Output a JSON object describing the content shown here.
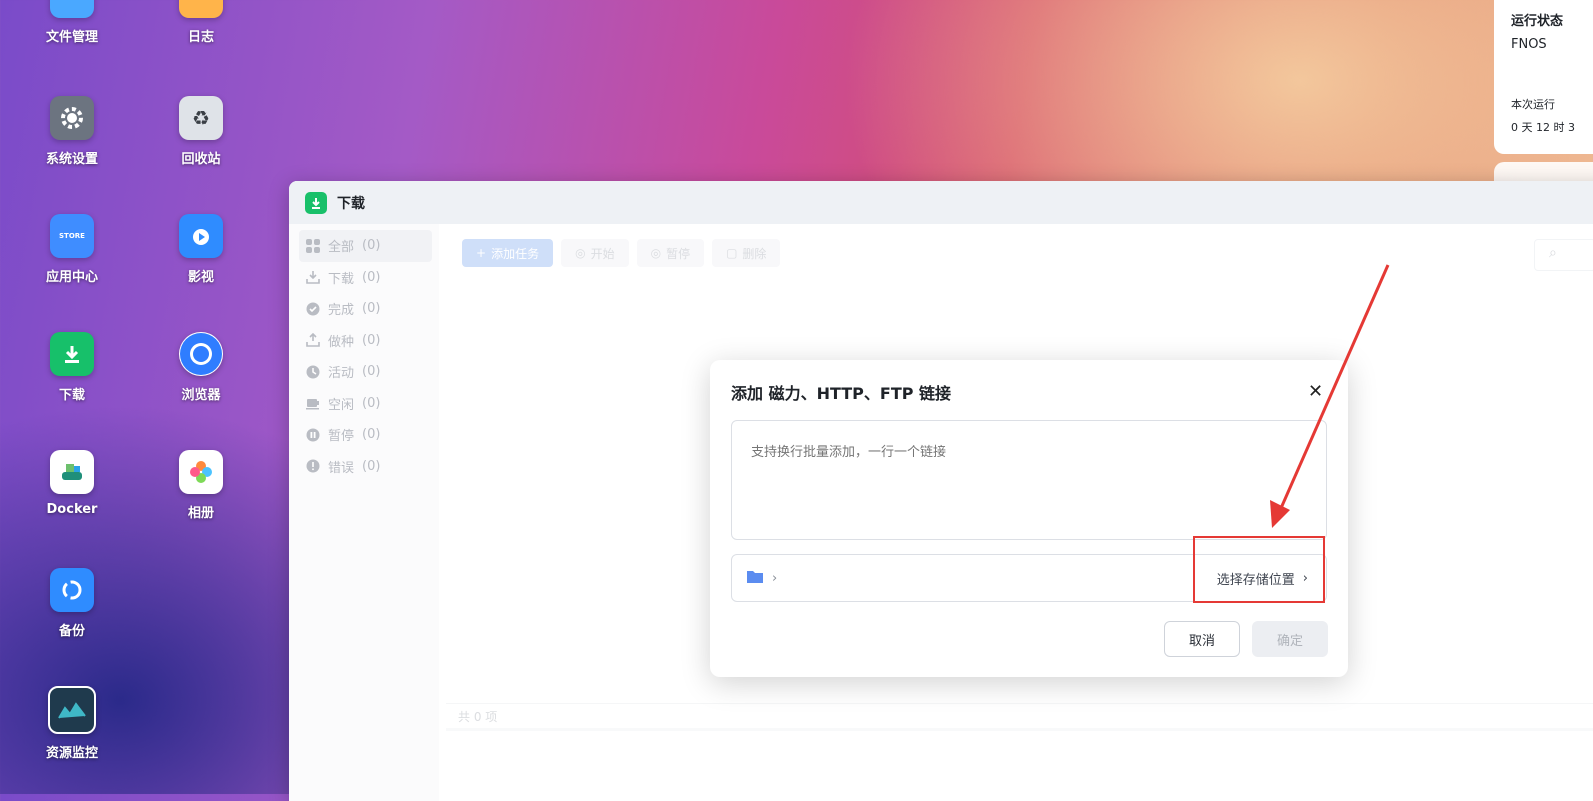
{
  "desktop": {
    "icons": [
      {
        "label": "文件管理",
        "icon": "folder-icon",
        "color": "#4aa8ff"
      },
      {
        "label": "日志",
        "icon": "log-icon",
        "color": "#ffb44a"
      },
      {
        "label": "系统设置",
        "icon": "gear-icon",
        "color": "#6c7480"
      },
      {
        "label": "回收站",
        "icon": "recycle-bin-icon",
        "color": "#dfe3e8"
      },
      {
        "label": "应用中心",
        "icon": "store-icon",
        "color": "#3f8dff"
      },
      {
        "label": "影视",
        "icon": "video-icon",
        "color": "#2f8cff"
      },
      {
        "label": "下载",
        "icon": "download-icon",
        "color": "#17c06a"
      },
      {
        "label": "浏览器",
        "icon": "browser-icon",
        "color": "#2f7dff"
      },
      {
        "label": "Docker",
        "icon": "docker-icon",
        "color": "#ffffff"
      },
      {
        "label": "相册",
        "icon": "photos-icon",
        "color": "#ffffff"
      },
      {
        "label": "备份",
        "icon": "backup-icon",
        "color": "#2f8cff"
      },
      {
        "label": "资源监控",
        "icon": "monitor-icon",
        "color": "#1f3a4d"
      }
    ]
  },
  "status_panel": {
    "heading": "运行状态",
    "os": "FNOS",
    "uptime_label": "本次运行",
    "uptime_value": "0 天 12 时 3"
  },
  "window": {
    "title": "下载",
    "sidebar": [
      {
        "label": "全部",
        "count": "(0)",
        "icon": "grid-icon"
      },
      {
        "label": "下载",
        "count": "(0)",
        "icon": "download-tray-icon"
      },
      {
        "label": "完成",
        "count": "(0)",
        "icon": "check-circle-icon"
      },
      {
        "label": "做种",
        "count": "(0)",
        "icon": "upload-tray-icon"
      },
      {
        "label": "活动",
        "count": "(0)",
        "icon": "activity-icon"
      },
      {
        "label": "空闲",
        "count": "(0)",
        "icon": "cup-icon"
      },
      {
        "label": "暂停",
        "count": "(0)",
        "icon": "pause-circle-icon"
      },
      {
        "label": "错误",
        "count": "(0)",
        "icon": "error-circle-icon"
      }
    ],
    "toolbar": {
      "add": "添加任务",
      "start": "开始",
      "pause": "暂停",
      "delete": "删除"
    },
    "footer": "共 0 项"
  },
  "dialog": {
    "title": "添加 磁力、HTTP、FTP 链接",
    "textarea_placeholder": "支持换行批量添加，一行一个链接",
    "choose_location": "选择存储位置",
    "cancel": "取消",
    "ok": "确定"
  },
  "annotation_color": "#e53935"
}
